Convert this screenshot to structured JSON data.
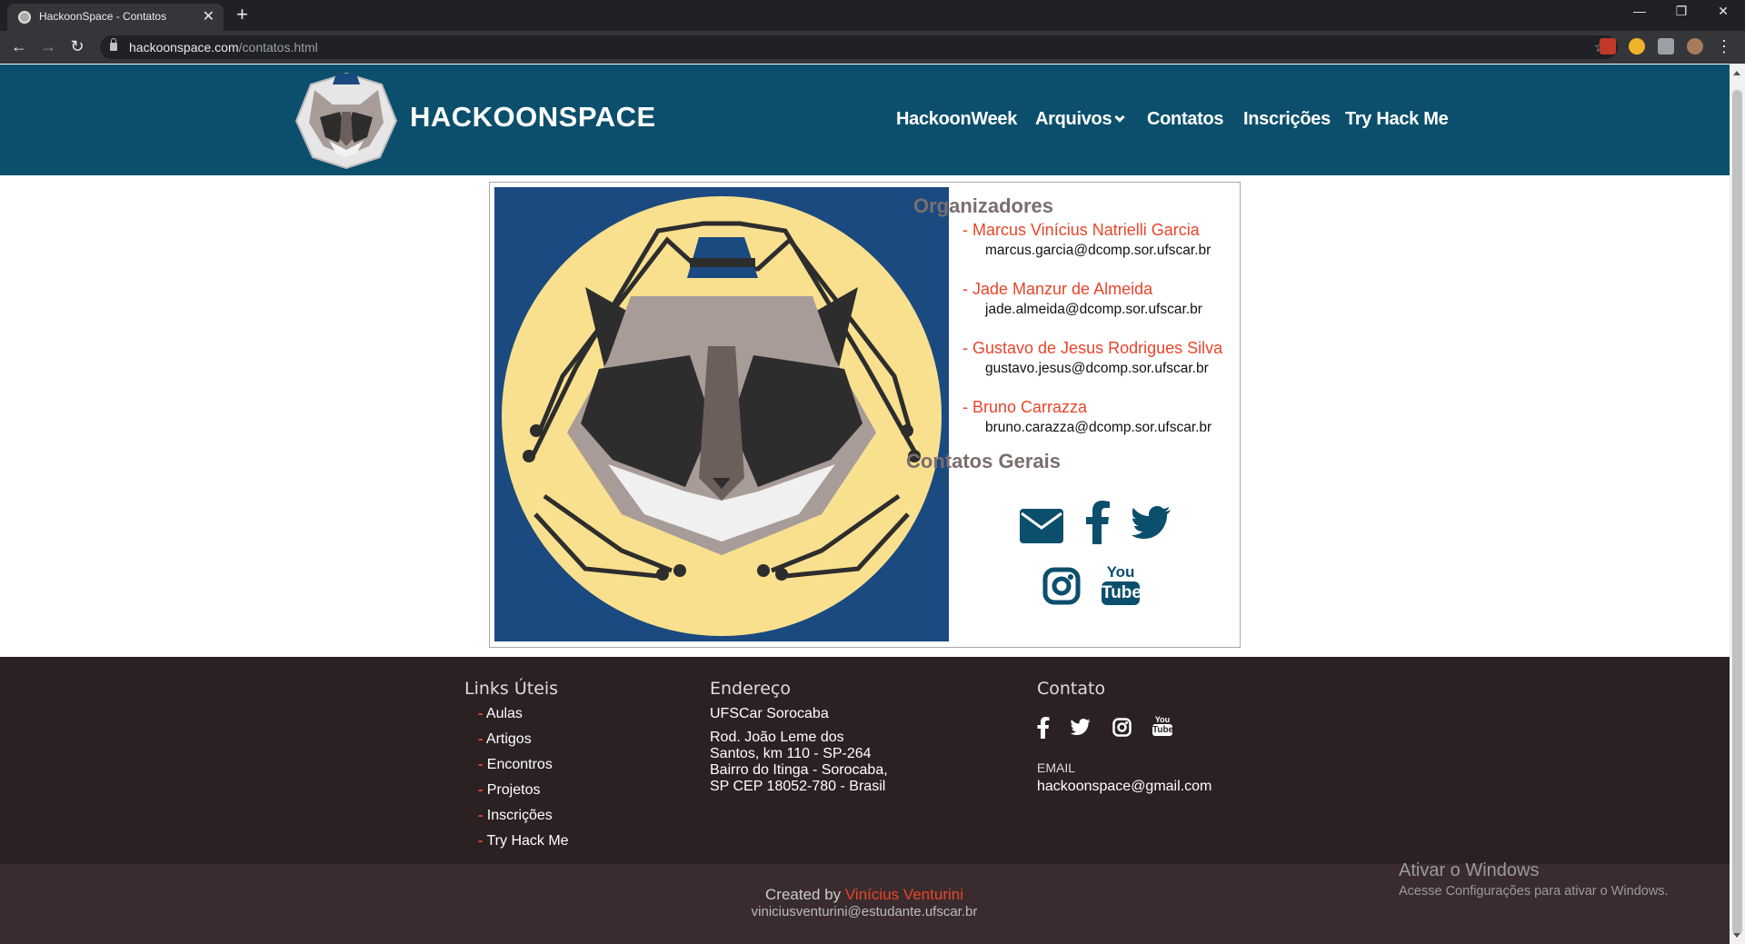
{
  "browser": {
    "tab_title": "HackoonSpace - Contatos",
    "url_host": "hackoonspace.com",
    "url_path": "/contatos.html"
  },
  "site": {
    "brand": "HACKOONSPACE",
    "nav": {
      "hackoonweek": "HackoonWeek",
      "arquivos": "Arquivos",
      "contatos": "Contatos",
      "inscricoes": "Inscrições",
      "tryhackme": "Try Hack Me"
    }
  },
  "organizers": {
    "title": "Organizadores",
    "people": [
      {
        "name": "- Marcus Vinícius Natrielli Garcia",
        "email": "marcus.garcia@dcomp.sor.ufscar.br"
      },
      {
        "name": "- Jade Manzur de Almeida",
        "email": "jade.almeida@dcomp.sor.ufscar.br"
      },
      {
        "name": "- Gustavo de Jesus Rodrigues Silva",
        "email": "gustavo.jesus@dcomp.sor.ufscar.br"
      },
      {
        "name": "- Bruno Carrazza",
        "email": "bruno.carazza@dcomp.sor.ufscar.br"
      }
    ]
  },
  "general_contacts": {
    "title": "Contatos Gerais",
    "icons": [
      "envelope-icon",
      "facebook-icon",
      "twitter-icon",
      "instagram-icon",
      "youtube-icon"
    ],
    "youtube_you": "You",
    "youtube_tube": "Tube"
  },
  "footer": {
    "links_title": "Links Úteis",
    "links": [
      {
        "dash": "-",
        "label": "Aulas"
      },
      {
        "dash": "-",
        "label": "Artigos"
      },
      {
        "dash": "-",
        "label": "Encontros"
      },
      {
        "dash": "-",
        "label": "Projetos"
      },
      {
        "dash": "-",
        "label": "Inscrições"
      },
      {
        "dash": "-",
        "label": "Try Hack Me"
      }
    ],
    "address_title": "Endereço",
    "address_name": "UFSCar Sorocaba",
    "address_lines": [
      "Rod. João Leme dos",
      "Santos, km 110 - SP-264",
      "Bairro do Itinga - Sorocaba,",
      "SP CEP 18052-780 - Brasil"
    ],
    "contact_title": "Contato",
    "email_label": "EMAIL",
    "email": "hackoonspace@gmail.com",
    "credit_prefix": "Created by ",
    "credit_name": "Vinícius Venturini",
    "credit_email": "viniciusventurini@estudante.ufscar.br"
  },
  "windows": {
    "activate_title": "Ativar o Windows",
    "activate_sub": "Acesse Configurações para ativar o Windows."
  },
  "colors": {
    "header": "#0b4f6c",
    "accent": "#e8452a",
    "footer": "#2b2123",
    "footer_bottom": "#3a2c2e",
    "icon_blue": "#0b4f6c"
  }
}
